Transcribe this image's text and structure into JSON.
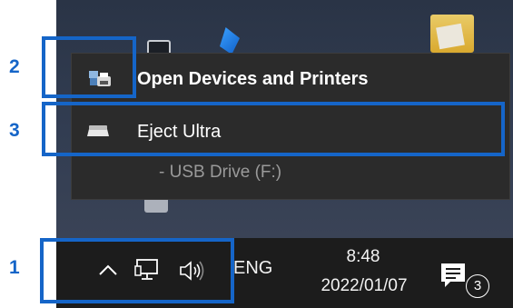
{
  "context_menu": {
    "open_devices_label": "Open Devices and Printers",
    "eject_label": "Eject Ultra",
    "usb_drive_label": "- USB Drive (F:)"
  },
  "taskbar": {
    "language": "ENG",
    "time": "8:48",
    "date": "2022/01/07",
    "notification_count": "3"
  },
  "annotations": {
    "step_1": "1",
    "step_2": "2",
    "step_3": "3"
  },
  "icons": {
    "devices": "devices-printers-icon",
    "drive": "usb-drive-icon",
    "chevron": "chevron-up-icon",
    "network": "network-icon",
    "volume": "volume-icon",
    "action_center": "action-center-icon"
  },
  "colors": {
    "highlight": "#1565c8",
    "menu_background": "#2b2b2b",
    "taskbar_background": "#1c1c1c",
    "disabled_text": "#9a9a9a"
  }
}
